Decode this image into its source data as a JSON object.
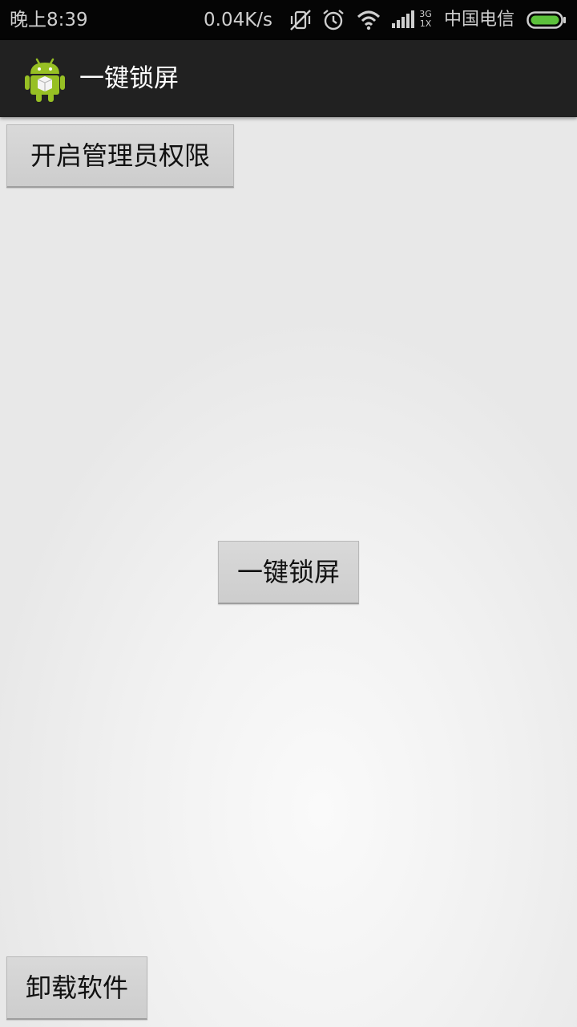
{
  "status_bar": {
    "time": "晚上8:39",
    "net_speed": "0.04K/s",
    "network_type": "3G",
    "network_sub": "1X",
    "carrier": "中国电信",
    "icons": [
      "vibrate-off-icon",
      "alarm-icon",
      "wifi-icon",
      "signal-icon",
      "battery-icon"
    ],
    "battery_color": "#5cc13b"
  },
  "action_bar": {
    "title": "一键锁屏",
    "icon": "android-app-icon",
    "icon_color": "#97c024"
  },
  "buttons": {
    "enable_admin": "开启管理员权限",
    "lock_screen": "一键锁屏",
    "uninstall": "卸载软件"
  }
}
